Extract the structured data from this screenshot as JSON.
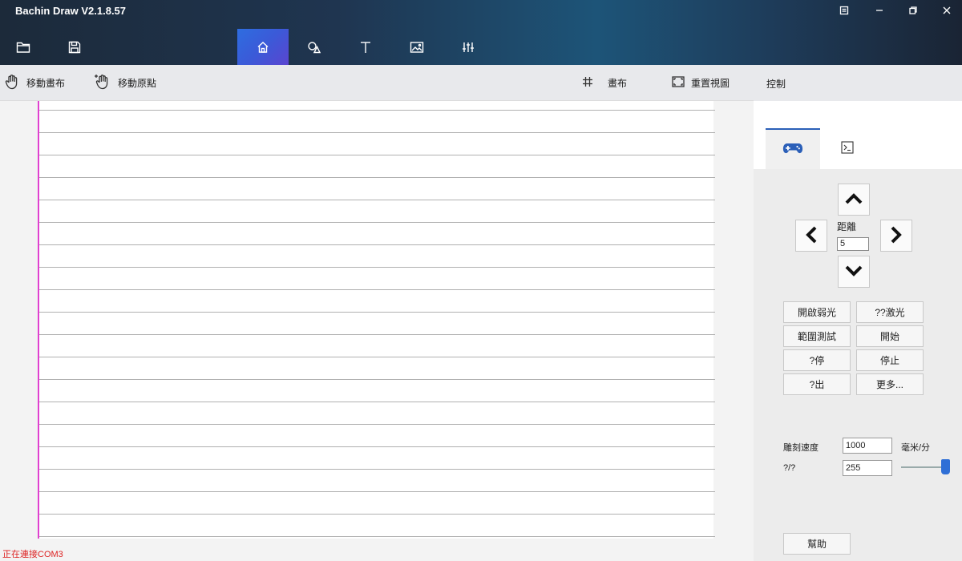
{
  "window": {
    "title": "Bachin Draw V2.1.8.57"
  },
  "toolbar": {
    "icons": [
      "folder-icon",
      "save-icon",
      "home-icon",
      "shapes-icon",
      "text-icon",
      "image-icon",
      "settings-sliders-icon"
    ],
    "active": "home-icon"
  },
  "subbar": {
    "move_canvas": "移動畫布",
    "move_origin": "移動原點",
    "canvas": "畫布",
    "reset_view": "重置視圖"
  },
  "panel": {
    "title": "控制",
    "tabs": [
      "gamepad-icon",
      "terminal-icon"
    ],
    "distance_label": "距離",
    "distance_value": "5",
    "buttons": [
      "開啟弱光",
      "??激光",
      "範圍測試",
      "開始",
      "?停",
      "停止",
      "?出",
      "更多..."
    ],
    "speed_label": "雕刻速度",
    "speed_value": "1000",
    "speed_unit": "毫米/分",
    "power_label": "?/?",
    "power_value": "255",
    "power_level": 1.0,
    "help": "幫助"
  },
  "status": "正在連接COM3",
  "colors": {
    "accent": "#2e6de0",
    "margin_line": "#e040d0",
    "status_text": "#dd2222"
  }
}
